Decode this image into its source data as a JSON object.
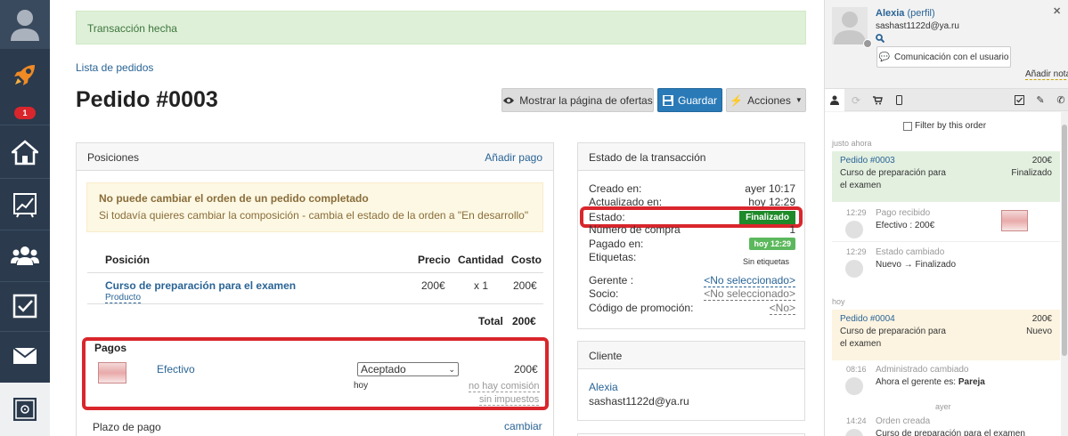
{
  "nav": {
    "badge": "1"
  },
  "alert": {
    "text": "Transacción hecha"
  },
  "breadcrumb": "Lista de pedidos",
  "title": "Pedido #0003",
  "buttons": {
    "offers": "Mostrar la página de ofertas",
    "save": "Guardar",
    "actions": "Acciones"
  },
  "positions": {
    "header": "Posiciones",
    "add_payment": "Añadir pago",
    "warning_title": "No puede cambiar el orden de un pedido completado",
    "warning_text": "Si todavía quieres cambiar la composición - cambia el estado de la orden a \"En desarrollo\"",
    "columns": {
      "position": "Posición",
      "price": "Precio",
      "qty": "Cantidad",
      "cost": "Costo"
    },
    "item": {
      "name": "Curso de preparación para el examen",
      "type": "Producto",
      "price": "200€",
      "qty": "x 1",
      "cost": "200€"
    },
    "total_label": "Total",
    "total_value": "200€",
    "payments_label": "Pagos",
    "payment": {
      "method": "Efectivo",
      "status": "Aceptado",
      "date": "hoy",
      "amount": "200€",
      "commission": "no hay comisión",
      "tax": "sin impuestos"
    },
    "term_label": "Plazo de pago",
    "term_link": "cambiar"
  },
  "transaction": {
    "header": "Estado de la transacción",
    "created_label": "Creado en:",
    "created_value": "ayer 10:17",
    "updated_label": "Actualizado en:",
    "updated_value": "hoy 12:29",
    "status_label": "Estado:",
    "status_value": "Finalizado",
    "purchase_label": "Número de compra",
    "purchase_value": "1",
    "paid_label": "Pagado en:",
    "paid_value": "hoy 12:29",
    "tags_label": "Etiquetas:",
    "tags_value": "Sin etiquetas",
    "manager_label": "Gerente :",
    "manager_value": "<No seleccionado>",
    "partner_label": "Socio:",
    "partner_value": "<No seleccionado>",
    "promo_label": "Código de promoción:",
    "promo_value": "<No>"
  },
  "client": {
    "header": "Cliente",
    "name": "Alexia",
    "email": "sashast1122d@ya.ru"
  },
  "sidebar": {
    "user_name": "Alexia",
    "profile": "(perfil)",
    "email": "sashast1122d@ya.ru",
    "contact_button": "Comunicación con el usuario",
    "add_note": "Añadir nota",
    "filter_label": "Filter by this order",
    "group1": "justo ahora",
    "order1": {
      "id": "Pedido #0003",
      "amount": "200€",
      "desc1": "Curso de preparación para",
      "desc2": "el examen",
      "status": "Finalizado"
    },
    "ev1": {
      "time": "12:29",
      "title": "Pago recibido",
      "text": "Efectivo : 200€"
    },
    "ev2": {
      "time": "12:29",
      "title": "Estado cambiado",
      "from": "Nuevo",
      "to": "Finalizado"
    },
    "group2": "hoy",
    "order2": {
      "id": "Pedido #0004",
      "amount": "200€",
      "desc1": "Curso de preparación para",
      "desc2": "el examen",
      "status": "Nuevo"
    },
    "ev3": {
      "time": "08:16",
      "title": "Administrado cambiado",
      "text": "Ahora el gerente es:",
      "bold": "Pareja"
    },
    "group3": "ayer",
    "ev4": {
      "time": "14:24",
      "title": "Orden creada",
      "text": "Curso de preparación para el examen"
    }
  },
  "colors": {
    "nav_bg": "#2b3a4d",
    "accent": "#2a7ab8",
    "alert_red": "#d9262c",
    "success_green": "#1e8a29"
  }
}
